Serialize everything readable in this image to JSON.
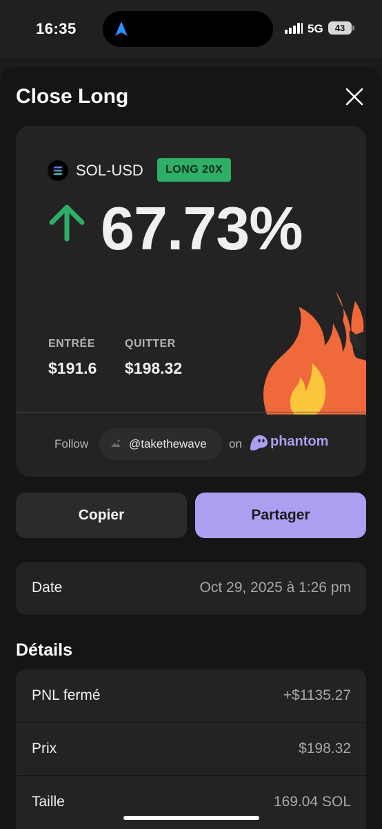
{
  "status_bar": {
    "time": "16:35",
    "network": "5G",
    "battery": "43",
    "icons": [
      "navigation-arrow-icon",
      "signal-icon",
      "battery-icon"
    ]
  },
  "sheet": {
    "title": "Close Long",
    "close_icon": "close-icon"
  },
  "card": {
    "token_icon": "solana-icon",
    "token": "SOL-USD",
    "badge": "LONG 20X",
    "direction_icon": "up-arrow-icon",
    "pnl_percent": "67.73%",
    "entry_label": "ENTRÉE",
    "entry_value": "$191.6",
    "exit_label": "QUITTER",
    "exit_value": "$198.32",
    "decoration_icon": "fire-icon",
    "follow_label": "Follow",
    "handle": "@takethewave",
    "on_label": "on",
    "brand": "phantom",
    "colors": {
      "accent": "#ab9ff2",
      "positive": "#2fae67"
    }
  },
  "actions": {
    "copy_label": "Copier",
    "share_label": "Partager"
  },
  "date_row": {
    "label": "Date",
    "value": "Oct 29, 2025 à 1:26 pm"
  },
  "details": {
    "title": "Détails",
    "rows": [
      {
        "label": "PNL fermé",
        "value": "+$1135.27"
      },
      {
        "label": "Prix",
        "value": "$198.32"
      },
      {
        "label": "Taille",
        "value": "169.04 SOL"
      }
    ]
  }
}
